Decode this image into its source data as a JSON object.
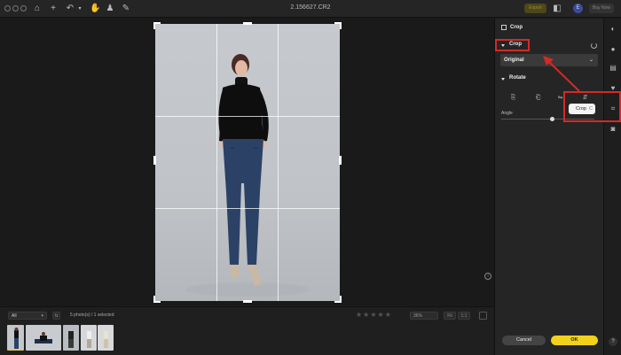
{
  "window": {
    "title": "2.156627.CR2"
  },
  "toolbar": {
    "export_label": "Export",
    "avatar_letter": "E",
    "buy_now_label": "Buy Now"
  },
  "panel": {
    "title": "Crop",
    "crop_section": {
      "label": "Crop",
      "aspect_value": "Original"
    },
    "rotate_section": {
      "label": "Rotate",
      "angle_label": "Angle",
      "angle_value_fraction": 0.55
    },
    "cancel_label": "Cancel",
    "ok_label": "OK"
  },
  "tooltip": {
    "label": "Crop",
    "shortcut": "C"
  },
  "filmstrip": {
    "filter_value": "All",
    "count_text": "5 photo(s) / 1 selected",
    "stars": "★★★★★",
    "zoom_value": "36%",
    "fit_label": "Fit",
    "one_to_one_label": "1:1",
    "thumbnail_count": 5,
    "selected_index": 0
  },
  "colors": {
    "accent": "#f2d11c",
    "annotation": "#d42a26",
    "panel_bg": "#252525",
    "canvas_bg": "#1a1a1a"
  },
  "icons": {
    "toolbar": [
      "home-icon",
      "plus-icon",
      "undo-icon",
      "hand-icon",
      "stamp-icon",
      "brush-icon"
    ],
    "rail": [
      "adjust-icon",
      "color-icon",
      "layers-icon",
      "heal-icon",
      "crop-icon",
      "camera-icon",
      "help-icon"
    ]
  }
}
